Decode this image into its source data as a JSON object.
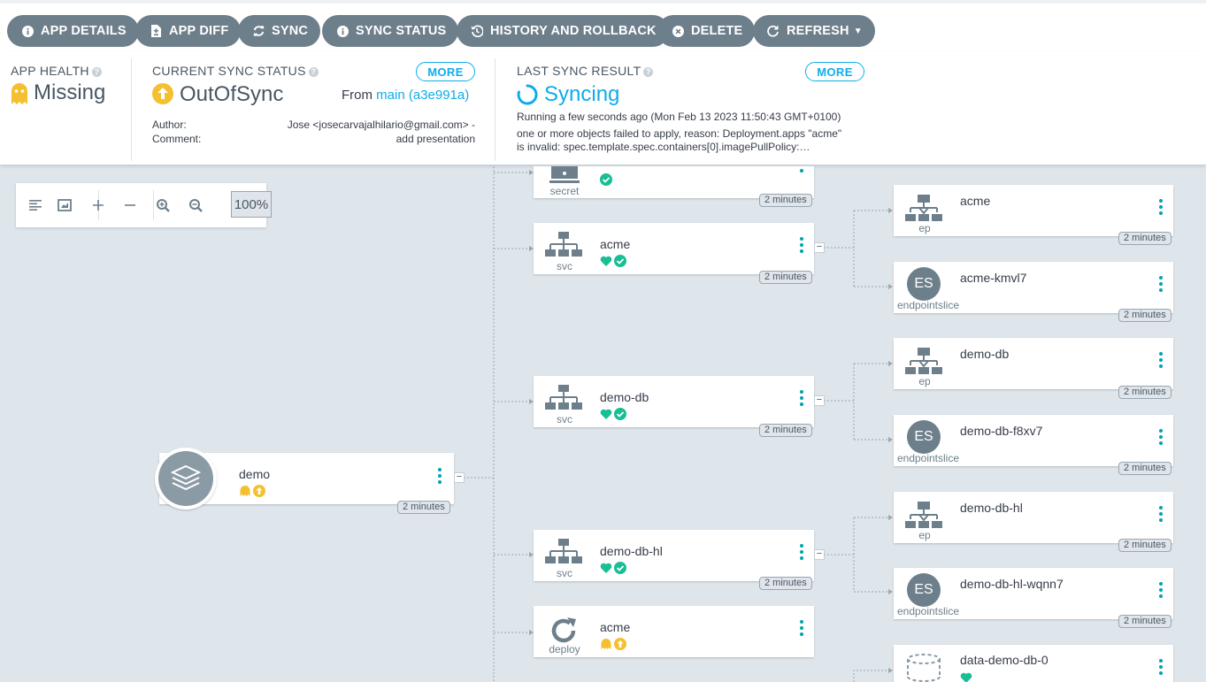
{
  "toolbar": {
    "buttons": [
      {
        "label": "APP DETAILS",
        "icon": "info-icon"
      },
      {
        "label": "APP DIFF",
        "icon": "file-diff-icon"
      },
      {
        "label": "SYNC",
        "icon": "sync-icon"
      },
      {
        "label": "SYNC STATUS",
        "icon": "info-icon"
      },
      {
        "label": "HISTORY AND ROLLBACK",
        "icon": "history-icon"
      },
      {
        "label": "DELETE",
        "icon": "delete-icon"
      },
      {
        "label": "REFRESH",
        "icon": "refresh-icon"
      }
    ]
  },
  "status": {
    "health": {
      "label": "APP HEALTH",
      "value": "Missing"
    },
    "sync": {
      "label": "CURRENT SYNC STATUS",
      "more": "MORE",
      "value": "OutOfSync",
      "from_prefix": "From",
      "from_ref": "main (a3e991a)",
      "author_label": "Author:",
      "author_value": "Jose <josecarvajalhilario@gmail.com> -",
      "comment_label": "Comment:",
      "comment_value": "add presentation"
    },
    "last_sync": {
      "label": "LAST SYNC RESULT",
      "more": "MORE",
      "value": "Syncing",
      "running": "Running a few seconds ago (Mon Feb 13 2023 11:50:43 GMT+0100)",
      "message_line1": "one or more objects failed to apply, reason: Deployment.apps \"acme\"",
      "message_line2": "is invalid: spec.template.spec.containers[0].imagePullPolicy:…"
    }
  },
  "graph": {
    "zoom": "100%",
    "colors": {
      "healthy": "#18be94",
      "missing": "#f4c030",
      "outofsync": "#f4c030",
      "progressing": "#0dadea",
      "icon": "#6d7f8b"
    },
    "root": {
      "name": "demo",
      "age": "2 minutes"
    },
    "nodes": {
      "secret": {
        "kind": "secret",
        "age": "2 minutes"
      },
      "svc_acme": {
        "name": "acme",
        "kind": "svc",
        "age": "2 minutes"
      },
      "svc_demo_db": {
        "name": "demo-db",
        "kind": "svc",
        "age": "2 minutes"
      },
      "svc_demo_db_hl": {
        "name": "demo-db-hl",
        "kind": "svc",
        "age": "2 minutes"
      },
      "deploy_acme": {
        "name": "acme",
        "kind": "deploy"
      },
      "ep_acme": {
        "name": "acme",
        "kind": "ep",
        "age": "2 minutes"
      },
      "es_acme": {
        "name": "acme-kmvl7",
        "kind": "endpointslice",
        "icon_text": "ES",
        "age": "2 minutes"
      },
      "ep_demo_db": {
        "name": "demo-db",
        "kind": "ep",
        "age": "2 minutes"
      },
      "es_demo_db": {
        "name": "demo-db-f8xv7",
        "kind": "endpointslice",
        "icon_text": "ES",
        "age": "2 minutes"
      },
      "ep_demo_db_hl": {
        "name": "demo-db-hl",
        "kind": "ep",
        "age": "2 minutes"
      },
      "es_demo_db_hl": {
        "name": "demo-db-hl-wqnn7",
        "kind": "endpointslice",
        "icon_text": "ES",
        "age": "2 minutes"
      },
      "pvc": {
        "name": "data-demo-db-0"
      }
    }
  }
}
